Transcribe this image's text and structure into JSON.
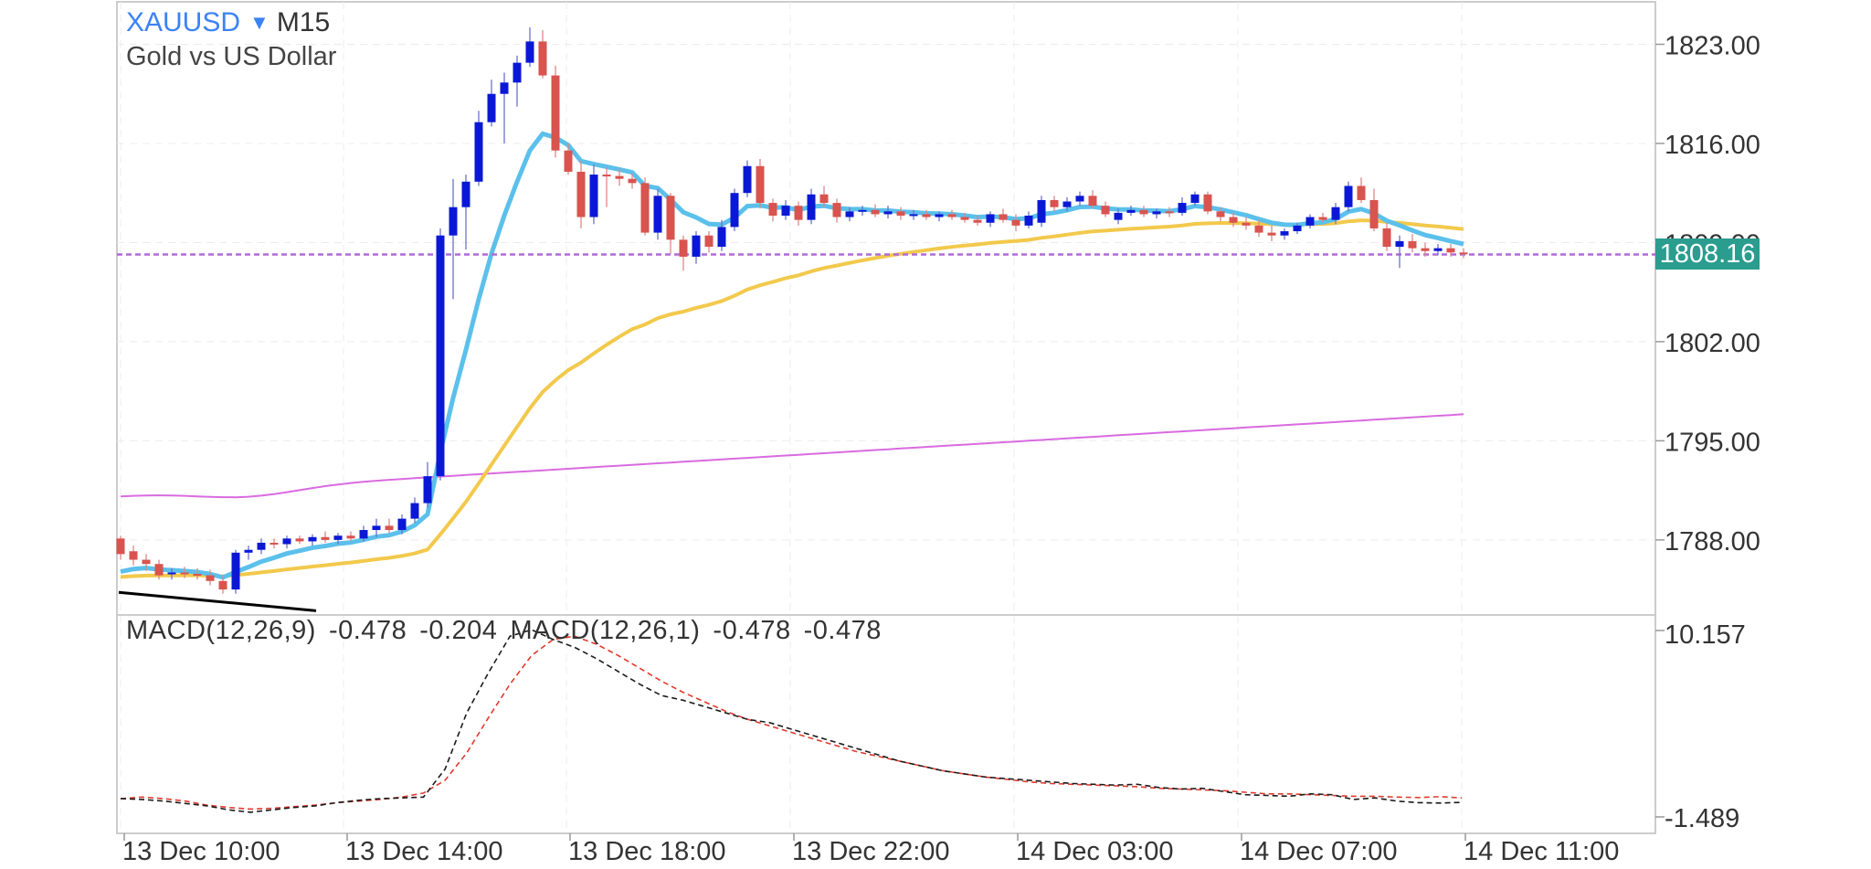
{
  "header": {
    "symbol": "XAUUSD",
    "timeframe": "M15",
    "description": "Gold vs US Dollar"
  },
  "current_price": "1808.16",
  "colors": {
    "bull": "#0a18d6",
    "bear": "#d9534f",
    "ma_fast": "#5bc0eb",
    "ma_slow": "#f2c94c",
    "ma_long": "#d96be0",
    "price_line": "#b06ad8",
    "price_tag": "#2a9d8f",
    "macd_main": "#1a1a1a",
    "macd_signal": "#e03a2e",
    "trendline": "#000000",
    "frame": "#cccccc",
    "grid": "#ececec"
  },
  "macd_labels": {
    "indicator1": "MACD(12,26,9)",
    "indicator1_main": "-0.478",
    "indicator1_signal": "-0.204",
    "indicator2": "MACD(12,26,1)",
    "indicator2_main": "-0.478",
    "indicator2_signal": "-0.478"
  },
  "chart_data": [
    {
      "type": "candlestick",
      "ylim": [
        1782.7,
        1826.0
      ],
      "y_ticks": [
        "1823.00",
        "1816.00",
        "1809.00",
        "1802.00",
        "1795.00",
        "1788.00"
      ],
      "x_ticks": [
        "13 Dec 10:00",
        "13 Dec 14:00",
        "13 Dec 18:00",
        "13 Dec 22:00",
        "14 Dec 03:00",
        "14 Dec 07:00",
        "14 Dec 11:00"
      ],
      "current_price": 1808.16,
      "candles": [
        [
          1788.1,
          1788.3,
          1786.6,
          1787.0
        ],
        [
          1787.2,
          1787.6,
          1786.2,
          1786.6
        ],
        [
          1786.6,
          1787.0,
          1785.8,
          1786.3
        ],
        [
          1786.3,
          1786.6,
          1785.2,
          1785.5
        ],
        [
          1785.6,
          1786.0,
          1785.2,
          1785.7
        ],
        [
          1785.7,
          1786.1,
          1785.3,
          1785.6
        ],
        [
          1785.6,
          1786.0,
          1785.2,
          1785.5
        ],
        [
          1785.5,
          1785.9,
          1784.8,
          1785.1
        ],
        [
          1785.1,
          1785.5,
          1784.2,
          1784.5
        ],
        [
          1784.5,
          1787.3,
          1784.2,
          1787.1
        ],
        [
          1787.1,
          1787.6,
          1786.6,
          1787.3
        ],
        [
          1787.3,
          1788.1,
          1787.0,
          1787.8
        ],
        [
          1787.8,
          1788.1,
          1787.4,
          1787.7
        ],
        [
          1787.7,
          1788.3,
          1787.4,
          1788.1
        ],
        [
          1788.1,
          1788.3,
          1787.7,
          1787.9
        ],
        [
          1787.9,
          1788.4,
          1787.6,
          1788.2
        ],
        [
          1788.2,
          1788.6,
          1787.8,
          1788.0
        ],
        [
          1788.0,
          1788.5,
          1787.7,
          1788.3
        ],
        [
          1788.3,
          1788.6,
          1787.9,
          1788.1
        ],
        [
          1788.1,
          1789.0,
          1787.9,
          1788.7
        ],
        [
          1788.7,
          1789.5,
          1788.2,
          1789.0
        ],
        [
          1789.0,
          1789.5,
          1788.5,
          1788.7
        ],
        [
          1788.7,
          1789.8,
          1788.4,
          1789.5
        ],
        [
          1789.5,
          1791.0,
          1789.2,
          1790.6
        ],
        [
          1790.6,
          1793.5,
          1790.3,
          1792.5
        ],
        [
          1792.5,
          1810.0,
          1792.2,
          1809.5
        ],
        [
          1809.5,
          1813.5,
          1805.0,
          1811.5
        ],
        [
          1811.5,
          1813.8,
          1808.5,
          1813.3
        ],
        [
          1813.3,
          1818.3,
          1813.0,
          1817.5
        ],
        [
          1817.5,
          1820.5,
          1817.2,
          1819.5
        ],
        [
          1819.5,
          1821.0,
          1816.0,
          1820.3
        ],
        [
          1820.3,
          1822.2,
          1818.6,
          1821.7
        ],
        [
          1821.7,
          1824.2,
          1821.4,
          1823.2
        ],
        [
          1823.2,
          1824.0,
          1820.6,
          1820.8
        ],
        [
          1820.8,
          1821.5,
          1815.0,
          1815.5
        ],
        [
          1815.5,
          1816.0,
          1813.8,
          1814.0
        ],
        [
          1814.0,
          1814.8,
          1810.0,
          1810.8
        ],
        [
          1810.8,
          1814.5,
          1810.3,
          1813.8
        ],
        [
          1813.8,
          1814.3,
          1811.5,
          1813.7
        ],
        [
          1813.7,
          1814.2,
          1813.0,
          1813.5
        ],
        [
          1813.5,
          1813.9,
          1812.8,
          1813.2
        ],
        [
          1813.2,
          1813.6,
          1809.5,
          1809.7
        ],
        [
          1809.7,
          1812.8,
          1809.2,
          1812.3
        ],
        [
          1812.3,
          1812.5,
          1808.2,
          1809.2
        ],
        [
          1809.2,
          1809.5,
          1807.0,
          1808.0
        ],
        [
          1808.0,
          1809.8,
          1807.5,
          1809.5
        ],
        [
          1809.5,
          1809.8,
          1808.3,
          1808.7
        ],
        [
          1808.7,
          1810.6,
          1808.4,
          1810.1
        ],
        [
          1810.1,
          1812.8,
          1809.8,
          1812.5
        ],
        [
          1812.5,
          1814.8,
          1812.2,
          1814.4
        ],
        [
          1814.4,
          1814.9,
          1811.4,
          1811.8
        ],
        [
          1811.8,
          1812.1,
          1810.5,
          1810.9
        ],
        [
          1810.9,
          1812.0,
          1810.6,
          1811.6
        ],
        [
          1811.6,
          1811.9,
          1810.2,
          1810.6
        ],
        [
          1810.6,
          1812.8,
          1810.3,
          1812.4
        ],
        [
          1812.4,
          1813.0,
          1811.5,
          1811.8
        ],
        [
          1811.8,
          1812.1,
          1810.4,
          1810.8
        ],
        [
          1810.8,
          1811.5,
          1810.5,
          1811.2
        ],
        [
          1811.2,
          1811.6,
          1810.9,
          1811.3
        ],
        [
          1811.3,
          1811.7,
          1810.8,
          1811.0
        ],
        [
          1811.0,
          1811.6,
          1810.7,
          1811.2
        ],
        [
          1811.2,
          1811.5,
          1810.6,
          1810.9
        ],
        [
          1810.9,
          1811.3,
          1810.6,
          1811.0
        ],
        [
          1811.0,
          1811.3,
          1810.6,
          1810.8
        ],
        [
          1810.8,
          1811.2,
          1810.5,
          1811.0
        ],
        [
          1811.0,
          1811.3,
          1810.6,
          1810.8
        ],
        [
          1810.8,
          1811.1,
          1810.4,
          1810.6
        ],
        [
          1810.6,
          1810.9,
          1810.2,
          1810.4
        ],
        [
          1810.4,
          1811.2,
          1810.1,
          1811.0
        ],
        [
          1811.0,
          1811.4,
          1810.4,
          1810.6
        ],
        [
          1810.6,
          1811.0,
          1809.8,
          1810.2
        ],
        [
          1810.2,
          1811.2,
          1810.0,
          1810.9
        ],
        [
          1810.4,
          1812.3,
          1810.1,
          1812.0
        ],
        [
          1812.0,
          1812.3,
          1811.2,
          1811.5
        ],
        [
          1811.5,
          1812.2,
          1811.2,
          1811.9
        ],
        [
          1811.9,
          1812.6,
          1811.6,
          1812.3
        ],
        [
          1812.3,
          1812.7,
          1811.4,
          1811.6
        ],
        [
          1811.6,
          1811.9,
          1810.8,
          1811.0
        ],
        [
          1810.6,
          1811.4,
          1810.3,
          1811.1
        ],
        [
          1811.1,
          1811.6,
          1810.9,
          1811.3
        ],
        [
          1811.3,
          1811.6,
          1810.8,
          1811.0
        ],
        [
          1811.0,
          1811.4,
          1810.7,
          1811.2
        ],
        [
          1811.2,
          1811.5,
          1810.8,
          1811.1
        ],
        [
          1811.1,
          1812.2,
          1810.9,
          1811.8
        ],
        [
          1811.8,
          1812.6,
          1811.6,
          1812.4
        ],
        [
          1812.4,
          1812.6,
          1811.0,
          1811.2
        ],
        [
          1811.2,
          1811.5,
          1810.5,
          1810.8
        ],
        [
          1810.8,
          1811.1,
          1810.1,
          1810.4
        ],
        [
          1810.4,
          1810.8,
          1809.9,
          1810.2
        ],
        [
          1810.2,
          1810.6,
          1809.4,
          1809.7
        ],
        [
          1809.7,
          1810.2,
          1809.1,
          1809.5
        ],
        [
          1809.5,
          1810.0,
          1809.2,
          1809.8
        ],
        [
          1809.8,
          1810.4,
          1809.6,
          1810.2
        ],
        [
          1810.2,
          1811.0,
          1810.0,
          1810.8
        ],
        [
          1810.8,
          1811.1,
          1810.4,
          1810.6
        ],
        [
          1810.6,
          1811.8,
          1810.3,
          1811.5
        ],
        [
          1811.5,
          1813.3,
          1811.2,
          1813.0
        ],
        [
          1813.0,
          1813.6,
          1811.8,
          1812.0
        ],
        [
          1812.0,
          1812.8,
          1809.8,
          1810.0
        ],
        [
          1810.0,
          1810.4,
          1808.4,
          1808.7
        ],
        [
          1808.7,
          1809.5,
          1807.2,
          1809.1
        ],
        [
          1809.1,
          1809.6,
          1808.3,
          1808.6
        ],
        [
          1808.6,
          1809.0,
          1808.0,
          1808.4
        ],
        [
          1808.4,
          1808.9,
          1808.1,
          1808.6
        ],
        [
          1808.6,
          1808.9,
          1808.0,
          1808.3
        ],
        [
          1808.3,
          1808.6,
          1807.9,
          1808.2
        ]
      ]
    },
    {
      "type": "line",
      "ylim": [
        -1.489,
        10.157
      ],
      "y_ticks": [
        "10.157",
        "-1.489"
      ],
      "series": [
        {
          "name": "MACD(12,26,9)",
          "values": [
            -0.35,
            -0.4,
            -0.5,
            -0.65,
            -0.8,
            -1.05,
            -1.2,
            -1.05,
            -0.9,
            -0.8,
            -0.6,
            -0.45,
            -0.35,
            -0.3,
            -0.25,
            1.5,
            5.0,
            7.5,
            9.8,
            10.2,
            9.6,
            9.1,
            8.4,
            7.6,
            6.8,
            6.1,
            5.8,
            5.4,
            5.0,
            4.6,
            4.4,
            4.0,
            3.6,
            3.2,
            2.8,
            2.4,
            2.0,
            1.7,
            1.4,
            1.2,
            1.0,
            0.9,
            0.8,
            0.7,
            0.6,
            0.55,
            0.5,
            0.55,
            0.35,
            0.25,
            0.3,
            0.1,
            -0.1,
            -0.15,
            -0.2,
            -0.05,
            -0.1,
            -0.4,
            -0.3,
            -0.5,
            -0.6,
            -0.62,
            -0.58
          ]
        },
        {
          "name": "MACD(12,26,9) signal",
          "values": [
            -0.35,
            -0.25,
            -0.35,
            -0.5,
            -0.75,
            -0.9,
            -1.0,
            -0.95,
            -0.85,
            -0.75,
            -0.6,
            -0.5,
            -0.4,
            -0.25,
            0.0,
            0.8,
            2.5,
            4.7,
            6.8,
            8.6,
            9.6,
            9.8,
            9.3,
            8.6,
            7.8,
            7.0,
            6.3,
            5.7,
            5.1,
            4.6,
            4.2,
            3.8,
            3.4,
            3.0,
            2.6,
            2.3,
            2.0,
            1.7,
            1.4,
            1.2,
            1.0,
            0.85,
            0.7,
            0.6,
            0.55,
            0.5,
            0.45,
            0.4,
            0.3,
            0.25,
            0.2,
            0.15,
            0.05,
            -0.05,
            -0.05,
            -0.1,
            -0.15,
            -0.2,
            -0.2,
            -0.25,
            -0.28,
            -0.22,
            -0.3
          ]
        }
      ]
    }
  ]
}
